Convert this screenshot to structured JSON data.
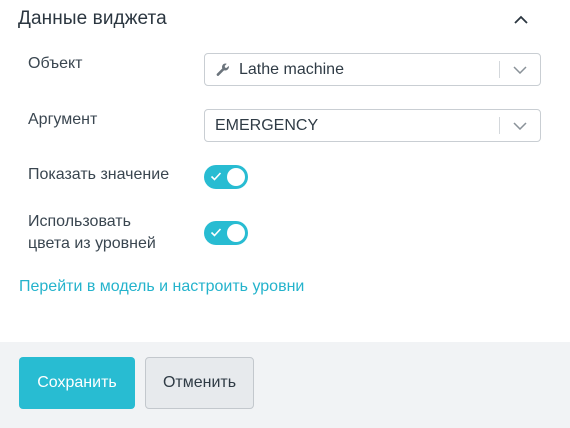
{
  "panel": {
    "title": "Данные виджета",
    "collapse_icon": "chevron-up-icon"
  },
  "fields": {
    "object": {
      "label": "Объект",
      "value": "Lathe machine",
      "icon": "wrench-icon"
    },
    "argument": {
      "label": "Аргумент",
      "value": "EMERGENCY"
    },
    "show_value": {
      "label": "Показать значение",
      "on": true
    },
    "use_level_colors": {
      "label_line1": "Использовать",
      "label_line2": "цвета из уровней",
      "on": true
    }
  },
  "link": {
    "text": "Перейти в модель и настроить уровни"
  },
  "footer": {
    "save_label": "Сохранить",
    "cancel_label": "Отменить"
  },
  "colors": {
    "accent": "#28bcd2",
    "link": "#24b3cc",
    "footer_bg": "#f1f3f5"
  }
}
